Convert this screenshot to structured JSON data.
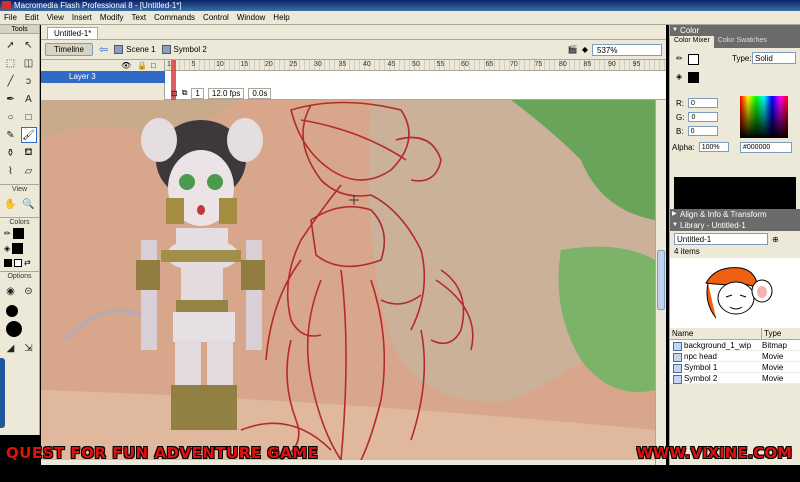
{
  "window": {
    "title": "Macromedia Flash Professional 8 - [Untitled-1*]"
  },
  "menu": [
    "File",
    "Edit",
    "View",
    "Insert",
    "Modify",
    "Text",
    "Commands",
    "Control",
    "Window",
    "Help"
  ],
  "tools": {
    "header": "Tools",
    "view_label": "View",
    "colors_label": "Colors",
    "options_label": "Options",
    "stroke_color": "#000000",
    "fill_color": "#000000"
  },
  "document": {
    "tab": "Untitled-1*",
    "timeline_button": "Timeline",
    "scene": "Scene 1",
    "symbol": "Symbol 2",
    "zoom": "537%"
  },
  "timeline": {
    "layer_name": "Layer 3",
    "frame_numbers": [
      "1",
      "5",
      "10",
      "15",
      "20",
      "25",
      "30",
      "35",
      "40",
      "45",
      "50",
      "55",
      "60",
      "65",
      "70",
      "75",
      "80",
      "85",
      "90",
      "95"
    ],
    "current_frame": "1",
    "fps": "12.0 fps",
    "time": "0.0s"
  },
  "color_panel": {
    "title": "Color",
    "tab_mixer": "Color Mixer",
    "tab_swatches": "Color Swatches",
    "type_label": "Type:",
    "type_value": "Solid",
    "r_label": "R:",
    "r_value": "0",
    "g_label": "G:",
    "g_value": "0",
    "b_label": "B:",
    "b_value": "0",
    "alpha_label": "Alpha:",
    "alpha_value": "100%",
    "hex": "#000000"
  },
  "align_panel": {
    "title": "Align & Info & Transform"
  },
  "library": {
    "title": "Library - Untitled-1",
    "doc": "Untitled-1",
    "count": "4 items",
    "col_name": "Name",
    "col_type": "Type",
    "items": [
      {
        "name": "background_1_wip",
        "type": "Bitmap"
      },
      {
        "name": "npc head",
        "type": "Movie"
      },
      {
        "name": "Symbol 1",
        "type": "Movie"
      },
      {
        "name": "Symbol 2",
        "type": "Movie"
      }
    ]
  },
  "overlay": {
    "left_text": "QUEST FOR FUN ADVENTURE GAME",
    "right_text": "WWW.VIXINE.COM"
  }
}
